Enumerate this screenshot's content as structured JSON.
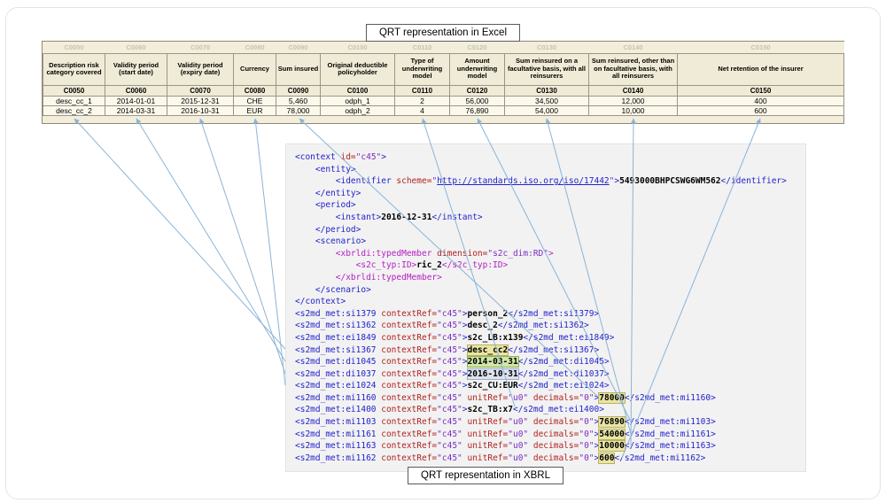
{
  "labels": {
    "excel": "QRT representation in Excel",
    "xbrl": "QRT representation in XBRL"
  },
  "table": {
    "ghost_codes": [
      "C0050",
      "C0060",
      "C0070",
      "C0080",
      "C0090",
      "C0100",
      "C0110",
      "C0120",
      "C0130",
      "C0140",
      "C0150"
    ],
    "headers": [
      "Description risk category covered",
      "Validity period (start date)",
      "Validity period (expiry date)",
      "Currency",
      "Sum insured",
      "Original deductible policyholder",
      "Type of underwriting model",
      "Amount underwriting model",
      "Sum reinsured on a facultative basis, with all reinsurers",
      "Sum reinsured, other than on facultative basis, with all reinsurers",
      "Net retention of the insurer"
    ],
    "codes": [
      "C0050",
      "C0060",
      "C0070",
      "C0080",
      "C0090",
      "C0100",
      "C0110",
      "C0120",
      "C0130",
      "C0140",
      "C0150"
    ],
    "rows": [
      [
        "desc_cc_1",
        "2014-01-01",
        "2015-12-31",
        "CHE",
        "5,460",
        "odph_1",
        "2",
        "56,000",
        "34,500",
        "12,000",
        "400"
      ],
      [
        "desc_cc_2",
        "2014-03-31",
        "2016-10-31",
        "EUR",
        "78,000",
        "odph_2",
        "4",
        "76,890",
        "54,000",
        "10,000",
        "600"
      ]
    ],
    "highlight_cells": [
      [
        0,
        3
      ],
      [
        1,
        3
      ],
      [
        0,
        6
      ],
      [
        1,
        6
      ]
    ]
  },
  "xbrl": {
    "lines": [
      [
        {
          "c": "tg",
          "x": "<context "
        },
        {
          "c": "at",
          "x": "id="
        },
        {
          "c": "vl",
          "x": "\"c45\""
        },
        {
          "c": "tg",
          "x": ">"
        }
      ],
      [
        {
          "c": "tg",
          "x": "    <entity>"
        }
      ],
      [
        {
          "c": "tg",
          "x": "        <identifier "
        },
        {
          "c": "at",
          "x": "scheme="
        },
        {
          "c": "vl",
          "x": "\""
        },
        {
          "c": "ln",
          "x": "http://standards.iso.org/iso/17442"
        },
        {
          "c": "vl",
          "x": "\""
        },
        {
          "c": "tg",
          "x": ">"
        },
        {
          "c": "tx",
          "x": "5493000BHPCSWG6WM562"
        },
        {
          "c": "tg",
          "x": "</identifier>"
        }
      ],
      [
        {
          "c": "tg",
          "x": "    </entity>"
        }
      ],
      [
        {
          "c": "tg",
          "x": "    <period>"
        }
      ],
      [
        {
          "c": "tg",
          "x": "        <instant>"
        },
        {
          "c": "tx",
          "x": "2016-12-31"
        },
        {
          "c": "tg",
          "x": "</instant>"
        }
      ],
      [
        {
          "c": "tg",
          "x": "    </period>"
        }
      ],
      [
        {
          "c": "tg",
          "x": "    <scenario>"
        }
      ],
      [
        {
          "c": "pu",
          "x": "        <xbrldi:typedMember "
        },
        {
          "c": "at",
          "x": "dimension="
        },
        {
          "c": "vl",
          "x": "\"s2c_dim:RD\""
        },
        {
          "c": "pu",
          "x": ">"
        }
      ],
      [
        {
          "c": "pu",
          "x": "            <s2c_typ:ID>"
        },
        {
          "c": "tx",
          "x": "ric_2"
        },
        {
          "c": "pu",
          "x": "</s2c_typ:ID>"
        }
      ],
      [
        {
          "c": "pu",
          "x": "        </xbrldi:typedMember>"
        }
      ],
      [
        {
          "c": "tg",
          "x": "    </scenario>"
        }
      ],
      [
        {
          "c": "tg",
          "x": "</context>"
        }
      ],
      [
        {
          "c": "tg",
          "x": "<s2md_met:si1379 "
        },
        {
          "c": "at",
          "x": "contextRef="
        },
        {
          "c": "vl",
          "x": "\"c45\""
        },
        {
          "c": "tg",
          "x": ">"
        },
        {
          "c": "tx",
          "x": "person_2"
        },
        {
          "c": "tg",
          "x": "</s2md_met:si1379>"
        }
      ],
      [
        {
          "c": "tg",
          "x": "<s2md_met:si1362 "
        },
        {
          "c": "at",
          "x": "contextRef="
        },
        {
          "c": "vl",
          "x": "\"c45\""
        },
        {
          "c": "tg",
          "x": ">"
        },
        {
          "c": "tx",
          "x": "desc_2"
        },
        {
          "c": "tg",
          "x": "</s2md_met:si1362>"
        }
      ],
      [
        {
          "c": "tg",
          "x": "<s2md_met:ei1849 "
        },
        {
          "c": "at",
          "x": "contextRef="
        },
        {
          "c": "vl",
          "x": "\"c45\""
        },
        {
          "c": "tg",
          "x": ">"
        },
        {
          "c": "tx",
          "x": "s2c_LB:x139"
        },
        {
          "c": "tg",
          "x": "</s2md_met:ei1849>"
        }
      ],
      [
        {
          "c": "tg",
          "x": "<s2md_met:si1367 "
        },
        {
          "c": "at",
          "x": "contextRef="
        },
        {
          "c": "vl",
          "x": "\"c45\""
        },
        {
          "c": "tg",
          "x": ">"
        },
        {
          "c": "tx hk",
          "x": "desc_cc2"
        },
        {
          "c": "tg",
          "x": "</s2md_met:si1367>"
        }
      ],
      [
        {
          "c": "tg",
          "x": "<s2md_met:di1045 "
        },
        {
          "c": "at",
          "x": "contextRef="
        },
        {
          "c": "vl",
          "x": "\"c45\""
        },
        {
          "c": "tg",
          "x": ">"
        },
        {
          "c": "tx hg",
          "x": "2014-03-31"
        },
        {
          "c": "tg",
          "x": "</s2md_met:di1045>"
        }
      ],
      [
        {
          "c": "tg",
          "x": "<s2md_met:di1037 "
        },
        {
          "c": "at",
          "x": "contextRef="
        },
        {
          "c": "vl",
          "x": "\"c45\""
        },
        {
          "c": "tg",
          "x": ">"
        },
        {
          "c": "tx hb",
          "x": "2016-10-31"
        },
        {
          "c": "tg",
          "x": "</s2md_met:di1037>"
        }
      ],
      [
        {
          "c": "tg",
          "x": "<s2md_met:ei1024 "
        },
        {
          "c": "at",
          "x": "contextRef="
        },
        {
          "c": "vl",
          "x": "\"c45\""
        },
        {
          "c": "tg",
          "x": ">"
        },
        {
          "c": "tx",
          "x": "s2c_CU:EUR"
        },
        {
          "c": "tg",
          "x": "</s2md_met:ei1024>"
        }
      ],
      [
        {
          "c": "tg",
          "x": "<s2md_met:mi1160 "
        },
        {
          "c": "at",
          "x": "contextRef="
        },
        {
          "c": "vl",
          "x": "\"c45\" "
        },
        {
          "c": "at",
          "x": "unitRef="
        },
        {
          "c": "vl",
          "x": "\"u0\" "
        },
        {
          "c": "at",
          "x": "decimals="
        },
        {
          "c": "vl",
          "x": "\"0\""
        },
        {
          "c": "tg",
          "x": ">"
        },
        {
          "c": "tx hk",
          "x": "78000"
        },
        {
          "c": "tg",
          "x": "</s2md_met:mi1160>"
        }
      ],
      [
        {
          "c": "tg",
          "x": "<s2md_met:ei1400 "
        },
        {
          "c": "at",
          "x": "contextRef="
        },
        {
          "c": "vl",
          "x": "\"c45\""
        },
        {
          "c": "tg",
          "x": ">"
        },
        {
          "c": "tx",
          "x": "s2c_TB:x7"
        },
        {
          "c": "tg",
          "x": "</s2md_met:ei1400>"
        }
      ],
      [
        {
          "c": "tg",
          "x": "<s2md_met:mi1103 "
        },
        {
          "c": "at",
          "x": "contextRef="
        },
        {
          "c": "vl",
          "x": "\"c45\" "
        },
        {
          "c": "at",
          "x": "unitRef="
        },
        {
          "c": "vl",
          "x": "\"u0\" "
        },
        {
          "c": "at",
          "x": "decimals="
        },
        {
          "c": "vl",
          "x": "\"0\""
        },
        {
          "c": "tg",
          "x": ">"
        },
        {
          "c": "tx hk",
          "x": "76890"
        },
        {
          "c": "tg",
          "x": "</s2md_met:mi1103>"
        }
      ],
      [
        {
          "c": "tg",
          "x": "<s2md_met:mi1161 "
        },
        {
          "c": "at",
          "x": "contextRef="
        },
        {
          "c": "vl",
          "x": "\"c45\" "
        },
        {
          "c": "at",
          "x": "unitRef="
        },
        {
          "c": "vl",
          "x": "\"u0\" "
        },
        {
          "c": "at",
          "x": "decimals="
        },
        {
          "c": "vl",
          "x": "\"0\""
        },
        {
          "c": "tg",
          "x": ">"
        },
        {
          "c": "tx hk",
          "x": "54000"
        },
        {
          "c": "tg",
          "x": "</s2md_met:mi1161>"
        }
      ],
      [
        {
          "c": "tg",
          "x": "<s2md_met:mi1163 "
        },
        {
          "c": "at",
          "x": "contextRef="
        },
        {
          "c": "vl",
          "x": "\"c45\" "
        },
        {
          "c": "at",
          "x": "unitRef="
        },
        {
          "c": "vl",
          "x": "\"u0\" "
        },
        {
          "c": "at",
          "x": "decimals="
        },
        {
          "c": "vl",
          "x": "\"0\""
        },
        {
          "c": "tg",
          "x": ">"
        },
        {
          "c": "tx hk",
          "x": "10000"
        },
        {
          "c": "tg",
          "x": "</s2md_met:mi1163>"
        }
      ],
      [
        {
          "c": "tg",
          "x": "<s2md_met:mi1162 "
        },
        {
          "c": "at",
          "x": "contextRef="
        },
        {
          "c": "vl",
          "x": "\"c45\" "
        },
        {
          "c": "at",
          "x": "unitRef="
        },
        {
          "c": "vl",
          "x": "\"u0\" "
        },
        {
          "c": "at",
          "x": "decimals="
        },
        {
          "c": "vl",
          "x": "\"0\""
        },
        {
          "c": "tg",
          "x": ">"
        },
        {
          "c": "tx hk",
          "x": "600"
        },
        {
          "c": "tg",
          "x": "</s2md_met:mi1162>"
        }
      ]
    ]
  }
}
